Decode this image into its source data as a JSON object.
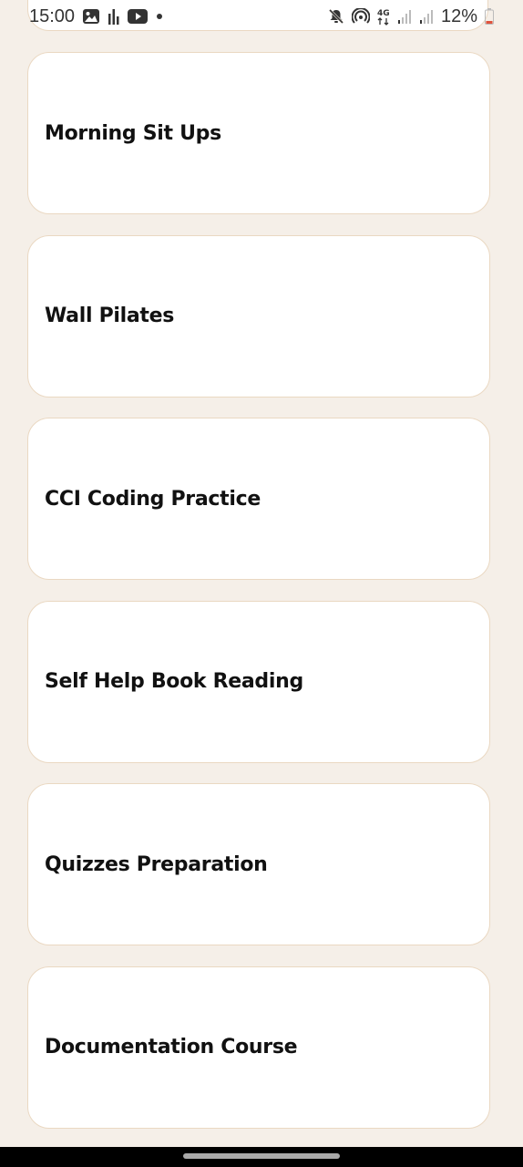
{
  "status_bar": {
    "time": "15:00",
    "battery_percent": "12%",
    "network_label": "4G",
    "left_icons": [
      "gallery-icon",
      "chart-bars-icon",
      "youtube-icon",
      "dot-icon"
    ],
    "right_icons": [
      "mute-icon",
      "hotspot-icon",
      "network-4g-icon",
      "signal-icon",
      "signal-icon",
      "battery-icon"
    ]
  },
  "cards": [
    {
      "label": "Morning Sit Ups"
    },
    {
      "label": "Wall Pilates"
    },
    {
      "label": "CCI Coding Practice"
    },
    {
      "label": "Self Help Book Reading"
    },
    {
      "label": "Quizzes Preparation"
    },
    {
      "label": "Documentation Course"
    }
  ],
  "colors": {
    "background": "#f5efe8",
    "card": "#ffffff",
    "card_border": "#ead8c2",
    "text": "#111111",
    "nav_bar": "#000000"
  }
}
